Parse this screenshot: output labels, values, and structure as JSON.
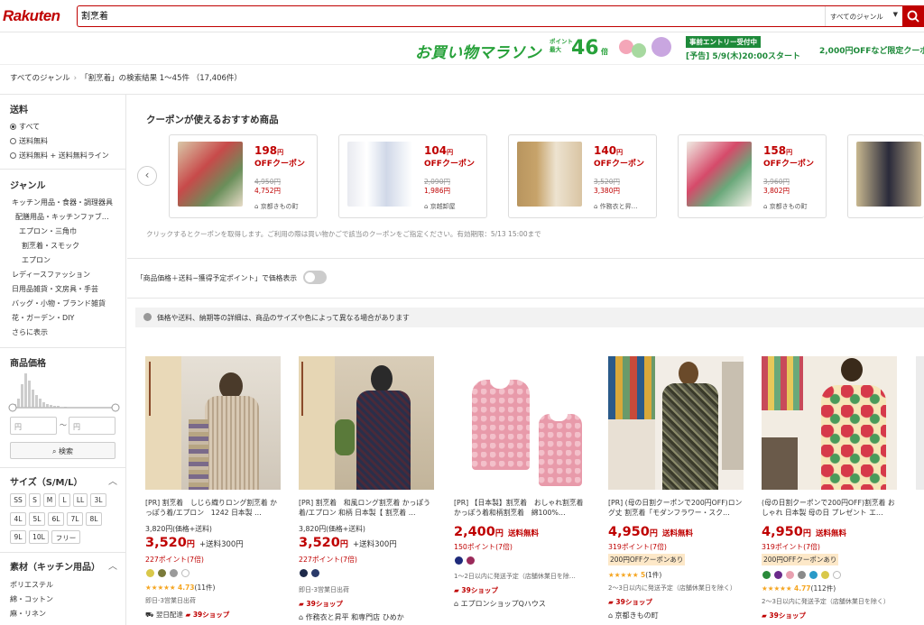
{
  "header": {
    "logo": "Rakuten",
    "search_value": "割烹着",
    "genre_select": "すべてのジャンル"
  },
  "banner": {
    "title": "お買い物マラソン",
    "point_label_1": "ポイント",
    "point_label_2": "最大",
    "multiplier": "46",
    "multiplier_unit": "倍",
    "entry_badge": "事前エントリー受付中",
    "entry_date": "[予告] 5/9(木)20:00スタート",
    "off_text": "2,000円OFFなど限定クーポ"
  },
  "breadcrumb": {
    "root": "すべてのジャンル",
    "sep": "›",
    "result": "「割烹着」の検索結果 1〜45件 （17,406件）"
  },
  "sidebar": {
    "shipping_title": "送料",
    "shipping_options": [
      "すべて",
      "送料無料",
      "送料無料 + 送料無料ライン"
    ],
    "genre_title": "ジャンル",
    "genres": [
      "キッチン用品・食器・調理器具",
      "配膳用品・キッチンファブ…",
      "エプロン・三角巾",
      "割烹着・スモック",
      "エプロン",
      "レディースファッション",
      "日用品雑貨・文房具・手芸",
      "バッグ・小物・ブランド雑貨",
      "花・ガーデン・DIY",
      "さらに表示"
    ],
    "price_title": "商品価格",
    "price_min_placeholder": "円",
    "price_tilde": "〜",
    "price_max_placeholder": "円",
    "price_search": "検索",
    "size_title": "サイズ（S/M/L）",
    "sizes": [
      "SS",
      "S",
      "M",
      "L",
      "LL",
      "3L",
      "4L",
      "5L",
      "6L",
      "7L",
      "8L",
      "9L",
      "10L",
      "フリー"
    ],
    "material_title": "素材（キッチン用品）",
    "materials": [
      "ポリエステル",
      "綿・コットン",
      "麻・リネン"
    ]
  },
  "coupons": {
    "title": "クーポンが使えるおすすめ商品",
    "note": "クリックするとクーポンを取得します。ご利用の際は買い物かごで該当のクーポンをご指定ください。有効期限：5/13 15:00まで",
    "off_label": "OFFクーポン",
    "items": [
      {
        "amount": "198",
        "unit": "円",
        "old": "4,950円",
        "new": "4,752円",
        "shop": "京都きもの町"
      },
      {
        "amount": "104",
        "unit": "円",
        "old": "2,090円",
        "new": "1,986円",
        "shop": "京越卸屋"
      },
      {
        "amount": "140",
        "unit": "円",
        "old": "3,520円",
        "new": "3,380円",
        "shop": "作務衣と昇…"
      },
      {
        "amount": "158",
        "unit": "円",
        "old": "3,960円",
        "new": "3,802円",
        "shop": "京都きもの町"
      }
    ]
  },
  "toggle_label": "「商品価格＋送料−獲得予定ポイント」で価格表示",
  "notice": "価格や送料、納期等の詳細は、商品のサイズや色によって異なる場合があります",
  "products": [
    {
      "title": "[PR] 割烹着　しじら織りロング割烹着 かっぽう着/エプロン　1242 日本製 …",
      "list_price": "3,820円(価格+送料)",
      "price": "3,520",
      "yen": "円",
      "shipping": "+送料300円",
      "points": "227ポイント(7倍)",
      "rating": "4.73",
      "count": "(11件)",
      "ship_info": "即日-3営業日出荷",
      "delivery": "翌日配達",
      "shop_badge": "39ショップ"
    },
    {
      "title": "[PR] 割烹着　和風ロング割烹着 かっぽう着/エプロン 和柄 日本製【 割烹着 …",
      "list_price": "3,820円(価格+送料)",
      "price": "3,520",
      "yen": "円",
      "shipping": "+送料300円",
      "points": "227ポイント(7倍)",
      "ship_info": "即日-3営業日出荷",
      "shop_badge": "39ショップ",
      "shop": "作務衣と昇平 和専門店 ひめか"
    },
    {
      "title": "[PR] 【日本製】割烹着　おしゃれ割烹着　かっぽう着和柄割烹着　綿100%…",
      "price": "2,400",
      "yen": "円",
      "free": "送料無料",
      "points": "150ポイント(7倍)",
      "ship_info": "1〜2日以内に発送予定（店舗休業日を除…",
      "shop_badge": "39ショップ",
      "shop": "エプロンショップQハウス"
    },
    {
      "title": "[PR] (母の日割クーポンで200円OFF)ロング丈 割烹着「モダンフラワー・スク…",
      "price": "4,950",
      "yen": "円",
      "free": "送料無料",
      "points": "319ポイント(7倍)",
      "coupon": "200円OFFクーポンあり",
      "rating": "5",
      "count": "(1件)",
      "ship_info": "2〜3日以内に発送予定（店舗休業日を除く）",
      "shop_badge": "39ショップ",
      "shop": "京都きもの町"
    },
    {
      "title": "(母の日割クーポンで200円OFF)割烹着 おしゃれ 日本製 母の日 プレゼント エ…",
      "price": "4,950",
      "yen": "円",
      "free": "送料無料",
      "points": "319ポイント(7倍)",
      "coupon": "200円OFFクーポンあり",
      "rating": "4.77",
      "count": "(112件)",
      "ship_info": "2〜3日以内に発送予定（店舗休業日を除く）",
      "shop_badge": "39ショップ"
    }
  ]
}
